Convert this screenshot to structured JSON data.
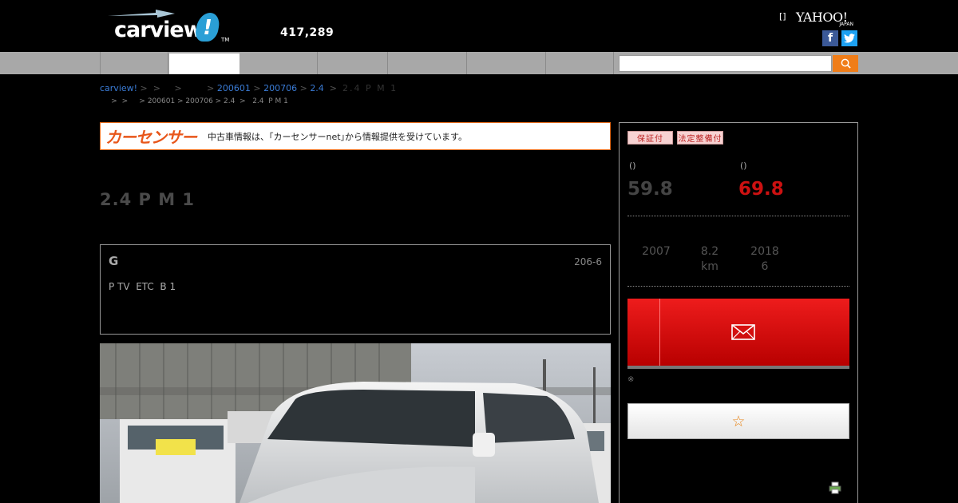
{
  "header": {
    "logo_text": "carview",
    "logo_mark": "!",
    "logo_tm": "TM",
    "count": "417,289",
    "bracket": "[]",
    "yahoo_text": "YAHOO!",
    "yahoo_sub": "JAPAN",
    "facebook_glyph": "f",
    "twitter_glyph": "t"
  },
  "breadcrumb": {
    "home": "carview!",
    "sep1": " >  >     >         > ",
    "date1": "200601",
    "sep2": " > ",
    "date2": "200706",
    "sep3": " > ",
    "grade": "2.4",
    "sep4": "  >  ",
    "current": "2.4 P M 1",
    "line2": "     >  >     > 200601 > 200706 > 2.4  >   2.4  P M 1"
  },
  "banner": {
    "logo": "カーセンサー",
    "text": "中古車情報は、｢カーセンサーnet｣から情報提供を受けています。"
  },
  "listing": {
    "title": "2.4 P M 1",
    "grade_letter": "G",
    "stock_id": "206-6",
    "options": "P TV  ETC  B 1"
  },
  "side": {
    "badge1": "保証付",
    "badge2": "法定整備付",
    "paren1": "()",
    "paren2": "()",
    "price1": "59.8",
    "price2": "69.8",
    "year": "2007",
    "mileage": "8.2",
    "mileage_unit": "km",
    "inspection": "2018",
    "inspection_month": "6",
    "note": "※",
    "fav_glyph": "☆"
  },
  "colors": {
    "accent_red": "#cc1111",
    "search_orange": "#f07d18",
    "link_blue": "#3a7bd5",
    "carsensor_orange": "#e8561a"
  }
}
